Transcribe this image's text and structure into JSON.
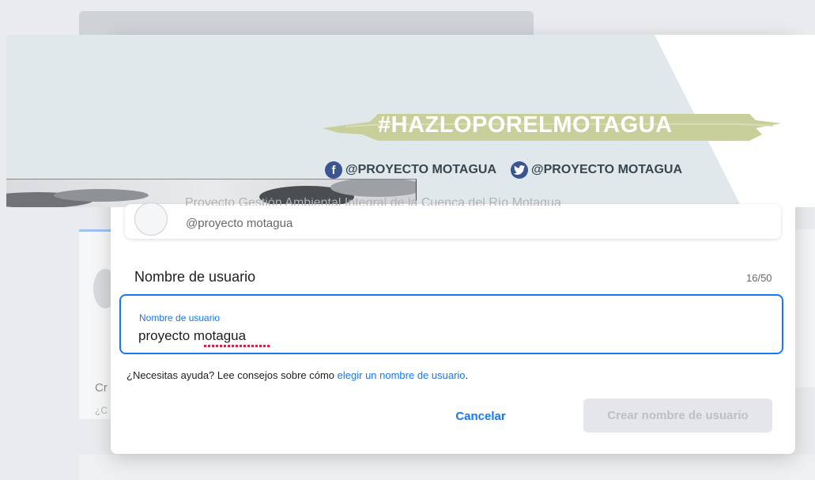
{
  "banner": {
    "hashtag": "#HAZLOPORELMOTAGUA",
    "facebook_icon": "facebook-icon",
    "facebook_handle": "@PROYECTO MOTAGUA",
    "twitter_icon": "twitter-icon",
    "twitter_handle": "@PROYECTO MOTAGUA"
  },
  "preview": {
    "page_name": "Proyecto Gestión Ambiental Integral de la Cuenca del Río Motagua",
    "handle": "@proyecto motagua"
  },
  "username": {
    "section_title": "Nombre de usuario",
    "counter": "16/50",
    "field_label": "Nombre de usuario",
    "value": "proyecto motagua"
  },
  "help": {
    "text": "¿Necesitas ayuda? Lee consejos sobre cómo ",
    "link": "elegir un nombre de usuario",
    "end": "."
  },
  "actions": {
    "cancel": "Cancelar",
    "create": "Crear nombre de usuario"
  },
  "background": {
    "partial_text_1": "Cr",
    "partial_text_2": "¿C"
  },
  "colors": {
    "accent": "#1877f2",
    "disabled_bg": "#e4e6eb",
    "banner_bg": "#e8edf0",
    "stripe": "#c8cf9a"
  }
}
